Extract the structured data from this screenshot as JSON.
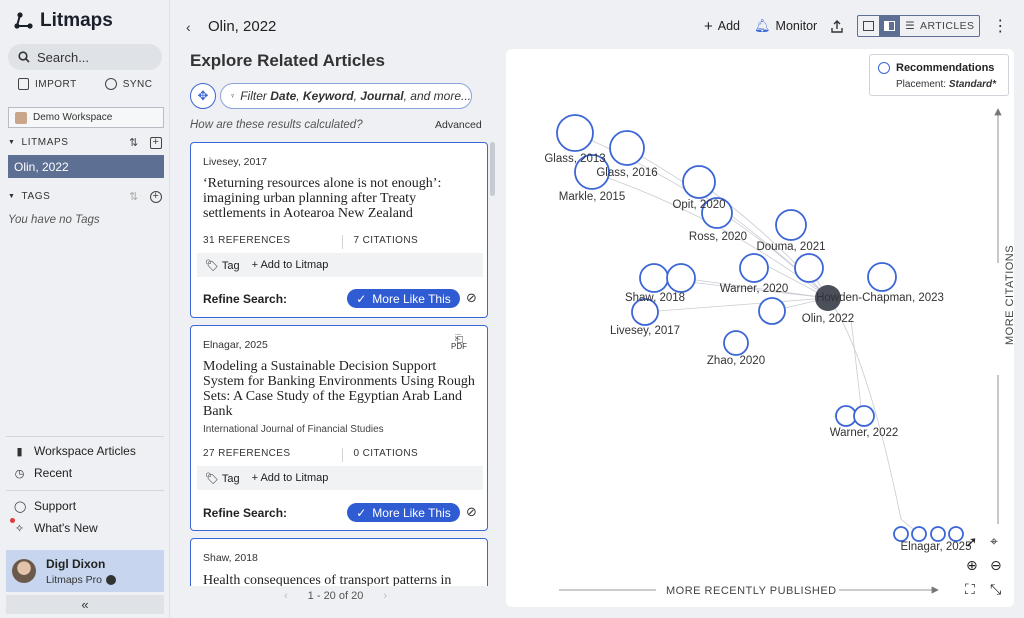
{
  "app": {
    "logo_text": "Litmaps"
  },
  "sidebar": {
    "search_placeholder": "Search...",
    "import_label": "IMPORT",
    "sync_label": "SYNC",
    "workspace": "Demo Workspace",
    "litmaps_label": "LITMAPS",
    "active_litmap": "Olin, 2022",
    "tags_label": "TAGS",
    "no_tags": "You have no Tags",
    "workspace_articles": "Workspace Articles",
    "recent": "Recent",
    "support": "Support",
    "whats_new": "What's New",
    "user_name": "Digl Dixon",
    "user_plan": "Litmaps Pro"
  },
  "header": {
    "title": "Olin, 2022",
    "add": "Add",
    "monitor": "Monitor",
    "articles": "ARTICLES"
  },
  "panel": {
    "heading": "Explore Related Articles",
    "filter_prefix": "Filter",
    "filter_f1": "Date",
    "filter_f2": "Keyword",
    "filter_f3": "Journal",
    "filter_suffix": ", and more...",
    "how": "How are these results calculated?",
    "advanced": "Advanced",
    "pager": "1 - 20 of 20"
  },
  "cards": [
    {
      "meta": "Livesey, 2017",
      "title": "‘Returning resources alone is not enough’: imagining urban planning after Treaty settlements in Aotearoa New Zealand",
      "journal": "",
      "references": "31 REFERENCES",
      "citations": "7 CITATIONS",
      "tag": "Tag",
      "add": "Add to Litmap",
      "refine": "Refine Search:",
      "more": "More Like This"
    },
    {
      "meta": "Elnagar, 2025",
      "title": "Modeling a Sustainable Decision Support System for Banking Environments Using Rough Sets: A Case Study of the Egyptian Arab Land Bank",
      "journal": "International Journal of Financial Studies",
      "references": "27 REFERENCES",
      "citations": "0 CITATIONS",
      "tag": "Tag",
      "add": "Add to Litmap",
      "refine": "Refine Search:",
      "more": "More Like This",
      "pdf": "PDF"
    },
    {
      "meta": "Shaw, 2018",
      "title": "Health consequences of transport patterns in"
    }
  ],
  "map": {
    "legend_title": "Recommendations",
    "legend_placement_label": "Placement:",
    "legend_placement_value": "Standard*",
    "axis_x": "MORE RECENTLY PUBLISHED",
    "axis_y": "MORE CITATIONS",
    "nodes": {
      "glass2013": "Glass, 2013",
      "glass2016": "Glass, 2016",
      "markle2015": "Markle, 2015",
      "opit2020": "Opit, 2020",
      "ross2020": "Ross, 2020",
      "douma2021": "Douma, 2021",
      "warner2020": "Warner, 2020",
      "shaw2018": "Shaw, 2018",
      "livesey2017": "Livesey, 2017",
      "howden": "Howden-Chapman, 2023",
      "olin2022": "Olin, 2022",
      "zhao2020": "Zhao, 2020",
      "warner2022": "Warner, 2022",
      "elnagar": "Elnagar, 2025"
    },
    "colors": {
      "accent": "#3b66d6",
      "seed": "#4a4f5a"
    }
  }
}
